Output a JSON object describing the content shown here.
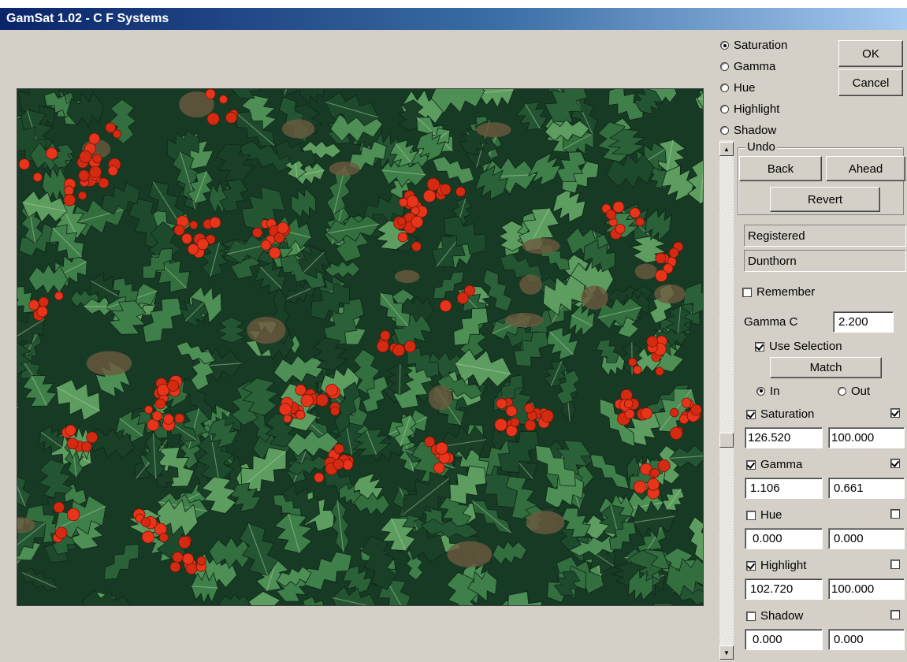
{
  "window": {
    "title": "GamSat 1.02 - C F Systems"
  },
  "mode_radios": [
    {
      "label": "Saturation",
      "selected": true
    },
    {
      "label": "Gamma",
      "selected": false
    },
    {
      "label": "Hue",
      "selected": false
    },
    {
      "label": "Highlight",
      "selected": false
    },
    {
      "label": "Shadow",
      "selected": false
    }
  ],
  "buttons": {
    "ok": "OK",
    "cancel": "Cancel",
    "back": "Back",
    "ahead": "Ahead",
    "revert": "Revert",
    "match": "Match"
  },
  "undo_group": {
    "label": "Undo"
  },
  "registration": {
    "line1": "Registered",
    "line2": "Dunthorn"
  },
  "remember": {
    "label": "Remember",
    "checked": false
  },
  "gamma_c": {
    "label": "Gamma C",
    "value": "2.200"
  },
  "use_selection": {
    "label": "Use Selection",
    "checked": true
  },
  "in_out": {
    "in_label": "In",
    "out_label": "Out",
    "selected": "In"
  },
  "adjustments": [
    {
      "label": "Saturation",
      "checked": true,
      "right_checked": true,
      "value1": "126.520",
      "value2": "100.000"
    },
    {
      "label": "Gamma",
      "checked": true,
      "right_checked": true,
      "value1": "1.106",
      "value2": "0.661"
    },
    {
      "label": "Hue",
      "checked": false,
      "right_checked": false,
      "value1": "0.000",
      "value2": "0.000"
    },
    {
      "label": "Highlight",
      "checked": true,
      "right_checked": false,
      "value1": "102.720",
      "value2": "100.000"
    },
    {
      "label": "Shadow",
      "checked": false,
      "right_checked": false,
      "value1": "0.000",
      "value2": "0.000"
    }
  ],
  "image": {
    "subject": "holly-with-red-berries"
  }
}
